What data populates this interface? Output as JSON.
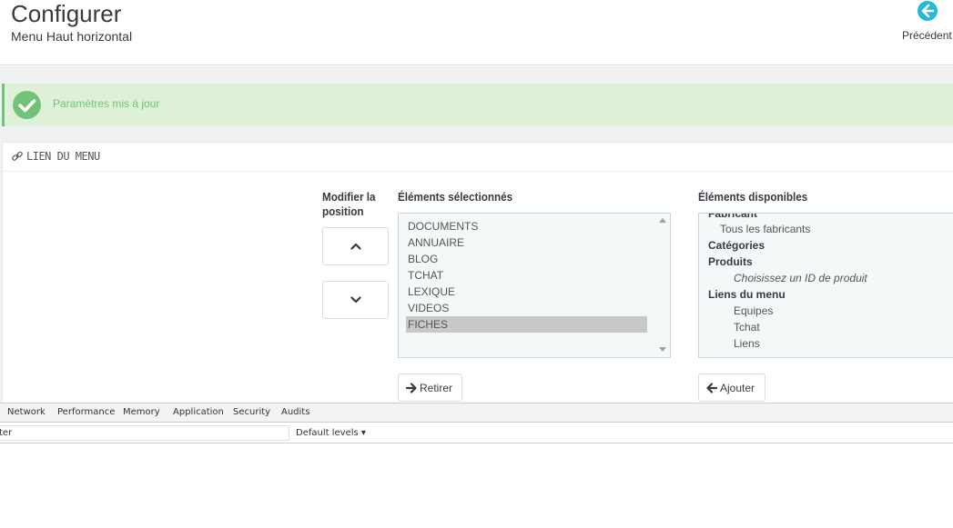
{
  "header": {
    "title": "Configurer",
    "subtitle": "Menu Haut horizontal",
    "back_label": "Précédent"
  },
  "alert": {
    "text": "Paramètres mis à jour",
    "color": "#72c279"
  },
  "panel": {
    "heading": "LIEN DU MENU",
    "position_label": "Modifier la position",
    "selected_label": "Éléments sélectionnés",
    "available_label": "Éléments disponibles",
    "selected_items": [
      {
        "label": "DOCUMENTS",
        "selected": false
      },
      {
        "label": "ANNUAIRE",
        "selected": false
      },
      {
        "label": "BLOG",
        "selected": false
      },
      {
        "label": "TCHAT",
        "selected": false
      },
      {
        "label": "LEXIQUE",
        "selected": false
      },
      {
        "label": "VIDEOS",
        "selected": false
      },
      {
        "label": "FICHES",
        "selected": true
      }
    ],
    "available_items": [
      {
        "label": "Fabricant",
        "type": "group"
      },
      {
        "label": "Tous les fabricants",
        "type": "lvl1"
      },
      {
        "label": "Catégories",
        "type": "group"
      },
      {
        "label": "Produits",
        "type": "group"
      },
      {
        "label": "Choisissez un ID de produit",
        "type": "ital"
      },
      {
        "label": "Liens du menu",
        "type": "group"
      },
      {
        "label": "Equipes",
        "type": "lvl2"
      },
      {
        "label": "Tchat",
        "type": "lvl2"
      },
      {
        "label": "Liens",
        "type": "lvl2"
      }
    ],
    "remove_label": "Retirer",
    "add_label": "Ajouter"
  },
  "devtools": {
    "tabs": [
      "Network",
      "Performance",
      "Memory",
      "Application",
      "Security",
      "Audits"
    ],
    "filter_value": "ter",
    "levels_label": "Default levels ▾"
  }
}
